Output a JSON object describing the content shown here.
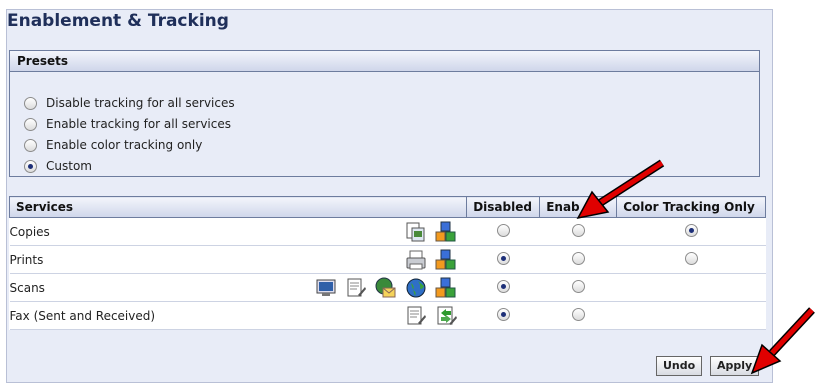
{
  "page": {
    "title": "Enablement & Tracking"
  },
  "presets": {
    "header": "Presets",
    "options": [
      {
        "label": "Disable tracking for all services",
        "selected": false
      },
      {
        "label": "Enable tracking for all services",
        "selected": false
      },
      {
        "label": "Enable color tracking only",
        "selected": false
      },
      {
        "label": "Custom",
        "selected": true
      }
    ]
  },
  "services": {
    "headers": {
      "services": "Services",
      "disabled": "Disabled",
      "enabled": "Enab",
      "color": "Color Tracking Only"
    },
    "rows": [
      {
        "name": "Copies",
        "icons": [
          "copy-scan-icon",
          "account-cubes-icon"
        ],
        "disabled": false,
        "enabled": false,
        "color": true
      },
      {
        "name": "Prints",
        "icons": [
          "printer-icon",
          "account-cubes-icon"
        ],
        "disabled": true,
        "enabled": false,
        "color": false
      },
      {
        "name": "Scans",
        "icons": [
          "scan-to-pc-icon",
          "scan-document-icon",
          "scan-to-email-icon",
          "scan-to-web-icon",
          "account-cubes-icon"
        ],
        "disabled": true,
        "enabled": false,
        "color": null
      },
      {
        "name": "Fax (Sent and Received)",
        "icons": [
          "fax-document-icon",
          "fax-send-receive-icon"
        ],
        "disabled": true,
        "enabled": false,
        "color": null
      }
    ]
  },
  "buttons": {
    "undo": "Undo",
    "apply": "Apply"
  },
  "colors": {
    "accent": "#1f2f5a",
    "panel_bg": "#e8ecf7",
    "arrow": "#e00000"
  }
}
